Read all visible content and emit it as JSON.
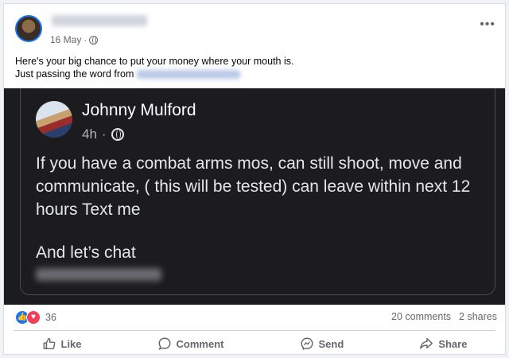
{
  "post": {
    "date": "16 May",
    "separator": "·",
    "more_label": "•••",
    "text_line1": "Here's your big chance to put your money where your mouth is.",
    "text_line2": "Just passing the word from"
  },
  "shared_post": {
    "author": "Johnny Mulford",
    "time": "4h",
    "separator": "·",
    "text": "If you have a combat arms mos, can still shoot, move and communicate, ( this will be tested) can leave within next 12 hours Text me",
    "text2": "And let’s chat"
  },
  "reactions": {
    "count": "36",
    "like_glyph": "👍",
    "love_glyph": "♥"
  },
  "stats": {
    "comments": "20 comments",
    "shares": "2 shares"
  },
  "actions": {
    "like": "Like",
    "comment": "Comment",
    "send": "Send",
    "share": "Share"
  },
  "colors": {
    "accent": "#1877f2",
    "love": "#f33e58",
    "dark_bg": "#1c1c1e"
  }
}
